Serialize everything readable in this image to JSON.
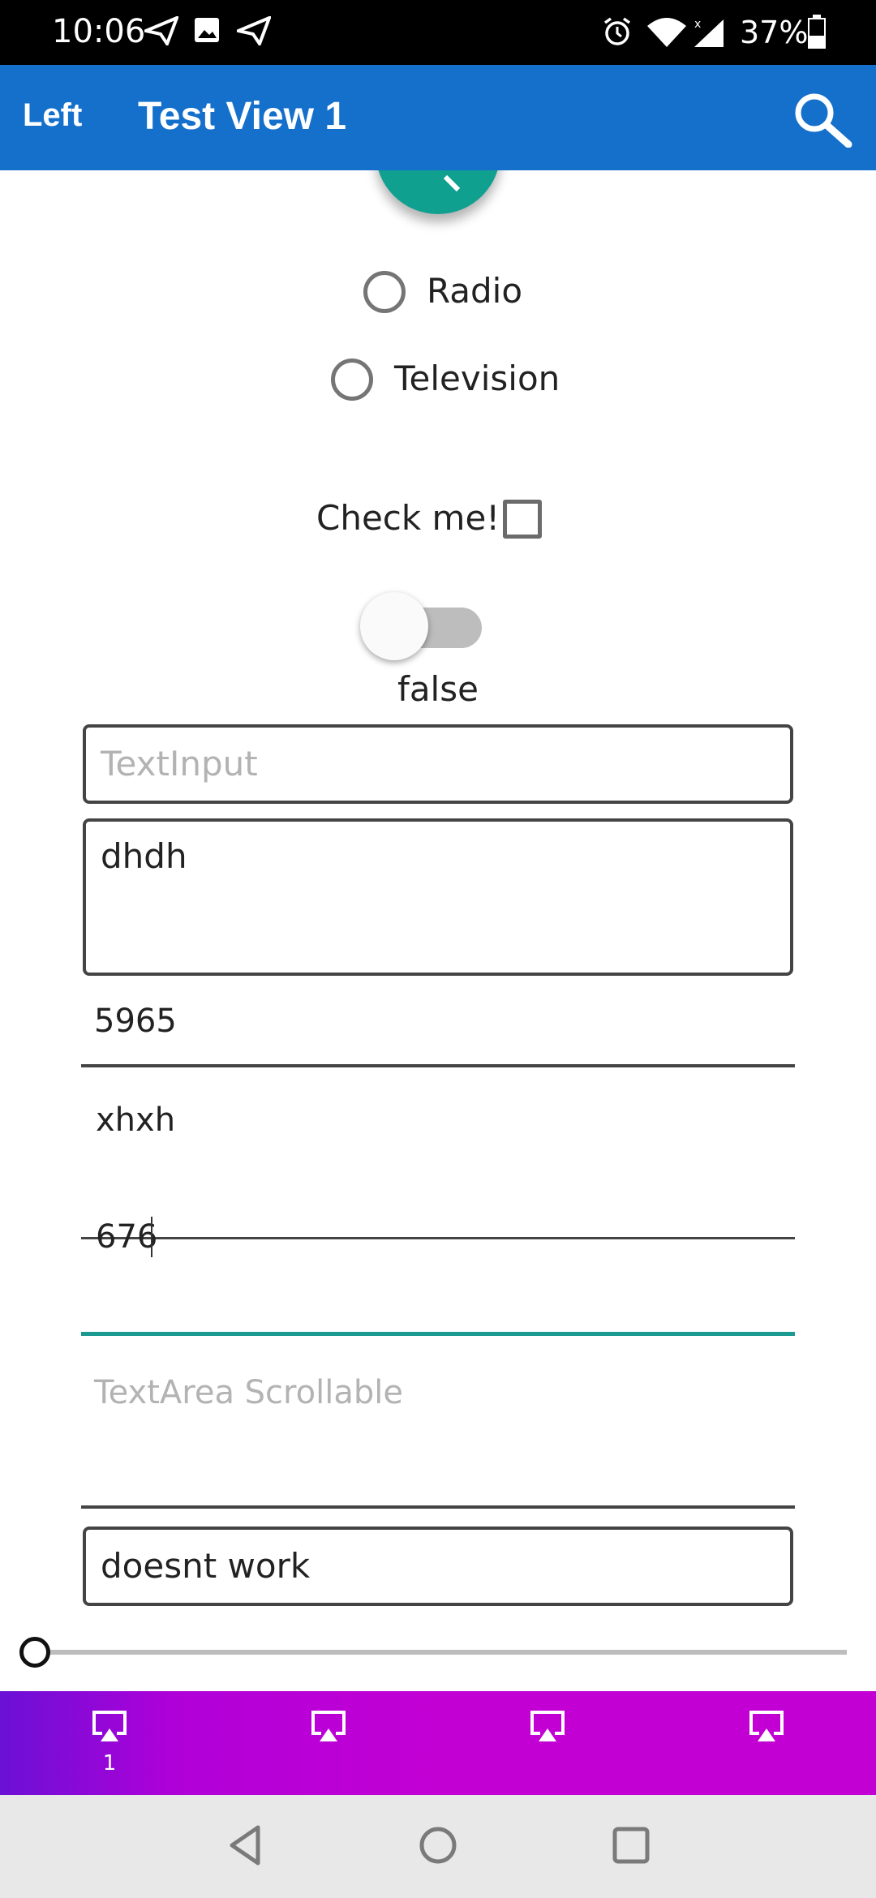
{
  "status_bar": {
    "time": "10:06",
    "battery": "37%"
  },
  "app_bar": {
    "left_label": "Left",
    "title": "Test View 1",
    "search_icon": "search-icon"
  },
  "radios": [
    {
      "label": "Radio"
    },
    {
      "label": "Television"
    }
  ],
  "checkbox": {
    "label": "Check me!",
    "checked": false
  },
  "toggle": {
    "state_text": "false"
  },
  "text_input": {
    "placeholder": "TextInput",
    "value": ""
  },
  "text_area": {
    "value": "dhdh"
  },
  "number_field": {
    "value": "5965"
  },
  "multiline_field": {
    "line1": "xhxh",
    "line2": "676"
  },
  "scroll_area": {
    "placeholder": "TextArea Scrollable"
  },
  "bottom_input": {
    "value": "doesnt work"
  },
  "slider": {
    "value": 0
  },
  "tabs": [
    {
      "icon": "cast-icon",
      "badge": "1"
    },
    {
      "icon": "cast-icon",
      "badge": ""
    },
    {
      "icon": "cast-icon",
      "badge": ""
    },
    {
      "icon": "cast-icon",
      "badge": ""
    }
  ],
  "colors": {
    "app_bar": "#1570cc",
    "fab": "#10a08f",
    "tab_bar_start": "#6b10d6",
    "tab_bar_end": "#c300d3",
    "focus_underline": "#1a9a90"
  }
}
